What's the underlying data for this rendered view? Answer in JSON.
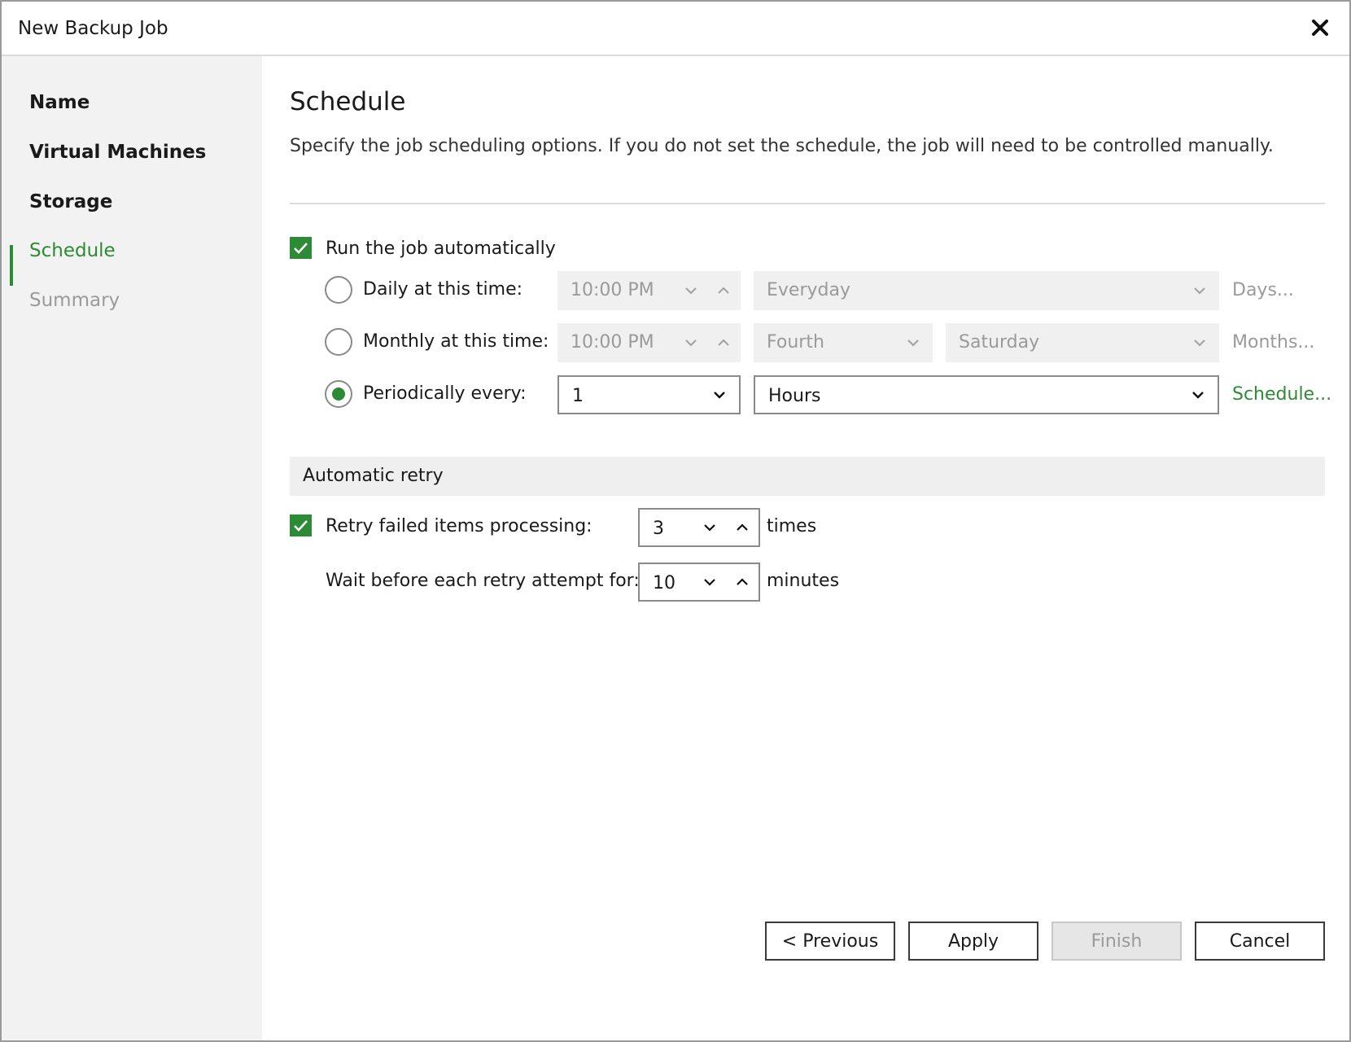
{
  "window": {
    "title": "New Backup Job"
  },
  "sidebar": {
    "items": [
      {
        "label": "Name"
      },
      {
        "label": "Virtual Machines"
      },
      {
        "label": "Storage"
      },
      {
        "label": "Schedule"
      },
      {
        "label": "Summary"
      }
    ]
  },
  "page": {
    "title": "Schedule",
    "description": "Specify the job scheduling options. If you do not set the schedule, the job will need to be controlled manually."
  },
  "schedule": {
    "run_auto_label": "Run the job automatically",
    "daily": {
      "label": "Daily at this time:",
      "time": "10:00 PM",
      "days": "Everyday",
      "link": "Days..."
    },
    "monthly": {
      "label": "Monthly at this time:",
      "time": "10:00 PM",
      "week": "Fourth",
      "day": "Saturday",
      "link": "Months..."
    },
    "periodic": {
      "label": "Periodically every:",
      "value": "1",
      "unit": "Hours",
      "link": "Schedule..."
    }
  },
  "retry": {
    "section_title": "Automatic retry",
    "retry_label": "Retry failed items processing:",
    "retry_value": "3",
    "retry_unit": "times",
    "wait_label": "Wait before each retry attempt for:",
    "wait_value": "10",
    "wait_unit": "minutes"
  },
  "buttons": {
    "previous": "< Previous",
    "apply": "Apply",
    "finish": "Finish",
    "cancel": "Cancel"
  },
  "colors": {
    "accent": "#2e8b35"
  }
}
